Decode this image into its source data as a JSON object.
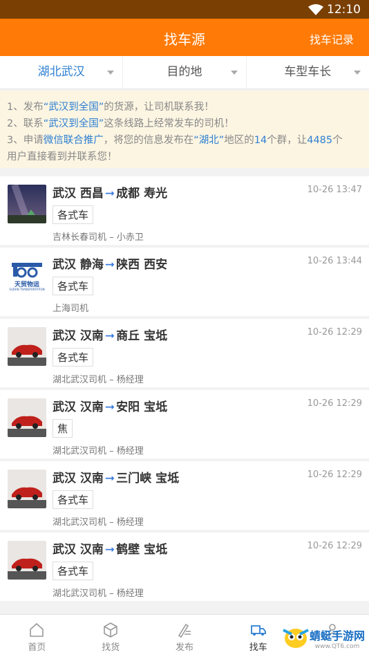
{
  "status": {
    "time": "12:10"
  },
  "header": {
    "title": "找车源",
    "right_label": "找车记录"
  },
  "filters": [
    {
      "label": "湖北武汉",
      "active": true
    },
    {
      "label": "目的地",
      "active": false
    },
    {
      "label": "车型车长",
      "active": false
    }
  ],
  "notice": {
    "l1_a": "1、发布",
    "l1_b": "“武汉到全国”",
    "l1_c": "的货源，让司机联系我！",
    "l2_a": "2、联系",
    "l2_b": "“武汉到全国”",
    "l2_c": "这条线路上经常发车的司机！",
    "l3_a": "3、申请",
    "l3_b": "微信联合推广",
    "l3_c": "，将您的信息发布在",
    "l3_d": "“湖北”",
    "l3_e": "地区的",
    "l3_f": "14",
    "l3_g": "个群，让",
    "l3_h": "4485",
    "l3_i": "个",
    "l4": "用户直接看到并联系您！"
  },
  "items": [
    {
      "from": "武汉 西昌",
      "to": "成都 寿光",
      "tag": "各式车",
      "meta": "吉林长春司机 – 小赤卫",
      "time": "10-26 13:47",
      "thumb": "night-sky"
    },
    {
      "from": "武汉 静海",
      "to": "陕西 西安",
      "tag": "各式车",
      "meta": "上海司机",
      "time": "10-26 13:44",
      "thumb": "logo"
    },
    {
      "from": "武汉 汉南",
      "to": "商丘 宝坻",
      "tag": "各式车",
      "meta": "湖北武汉司机 – 杨经理",
      "time": "10-26 12:29",
      "thumb": "car"
    },
    {
      "from": "武汉 汉南",
      "to": "安阳 宝坻",
      "tag": "焦",
      "meta": "湖北武汉司机 – 杨经理",
      "time": "10-26 12:29",
      "thumb": "car"
    },
    {
      "from": "武汉 汉南",
      "to": "三门峡 宝坻",
      "tag": "各式车",
      "meta": "湖北武汉司机 – 杨经理",
      "time": "10-26 12:29",
      "thumb": "car"
    },
    {
      "from": "武汉 汉南",
      "to": "鹤壁 宝坻",
      "tag": "各式车",
      "meta": "湖北武汉司机 – 杨经理",
      "time": "10-26 12:29",
      "thumb": "car"
    }
  ],
  "logo_text": {
    "line1": "天贸物运",
    "line2": "SUDAN TRANSPORTATION"
  },
  "tabs": [
    {
      "label": "首页",
      "icon": "home-icon"
    },
    {
      "label": "找货",
      "icon": "box-icon"
    },
    {
      "label": "发布",
      "icon": "pen-icon"
    },
    {
      "label": "找车",
      "icon": "truck-icon",
      "active": true
    },
    {
      "label": "",
      "icon": "user-icon"
    }
  ],
  "watermark": {
    "name": "蜻蜓手游网",
    "url": "www.QT6.com"
  },
  "colors": {
    "header": "#ff7a06",
    "accent": "#2d7fd2",
    "notice_bg": "#fcf5e2"
  }
}
